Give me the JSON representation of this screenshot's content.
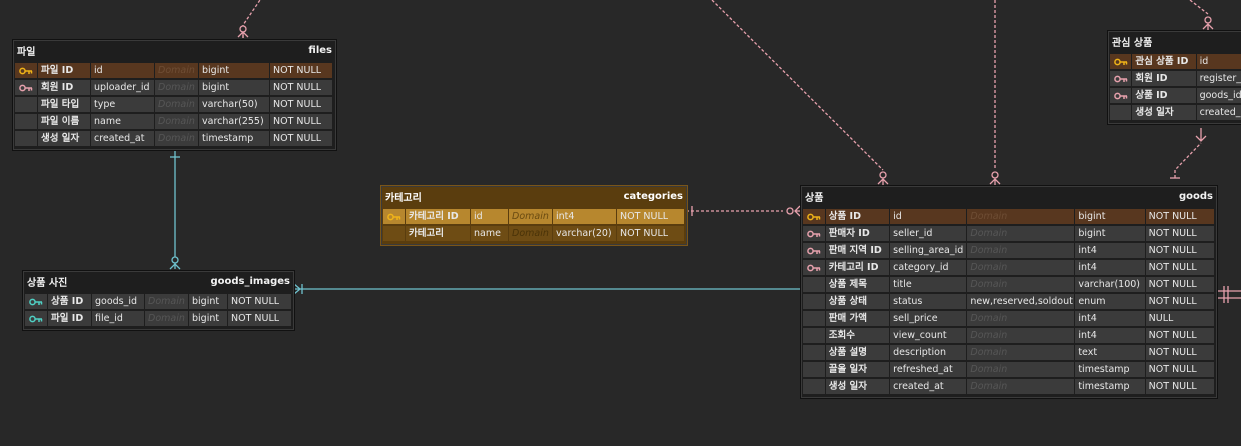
{
  "colors": {
    "background": "#282828",
    "pk_row": "#58371f",
    "selected_table": "#b7872e",
    "pk_key_icon": "#f0b418",
    "fk_key_icon": "#e7a1ad",
    "relation_pink": "#e7a1ad",
    "relation_cyan": "#6fc3cf"
  },
  "tables": {
    "files": {
      "logical": "파일",
      "physical": "files",
      "rows": [
        {
          "key": "pk",
          "lname": "파일 ID",
          "pname": "id",
          "domain": "Domain",
          "type": "bigint",
          "nullable": "NOT NULL"
        },
        {
          "key": "fk",
          "lname": "회원 ID",
          "pname": "uploader_id",
          "domain": "Domain",
          "type": "bigint",
          "nullable": "NOT NULL"
        },
        {
          "key": "",
          "lname": "파일 타입",
          "pname": "type",
          "domain": "Domain",
          "type": "varchar(50)",
          "nullable": "NOT NULL"
        },
        {
          "key": "",
          "lname": "파일 이름",
          "pname": "name",
          "domain": "Domain",
          "type": "varchar(255)",
          "nullable": "NOT NULL"
        },
        {
          "key": "",
          "lname": "생성 일자",
          "pname": "created_at",
          "domain": "Domain",
          "type": "timestamp",
          "nullable": "NOT NULL"
        }
      ]
    },
    "goods_images": {
      "logical": "상품 사진",
      "physical": "goods_images",
      "rows": [
        {
          "key": "pfk",
          "lname": "상품 ID",
          "pname": "goods_id",
          "domain": "Domain",
          "type": "bigint",
          "nullable": "NOT NULL"
        },
        {
          "key": "pfk",
          "lname": "파일 ID",
          "pname": "file_id",
          "domain": "Domain",
          "type": "bigint",
          "nullable": "NOT NULL"
        }
      ]
    },
    "categories": {
      "logical": "카테고리",
      "physical": "categories",
      "rows": [
        {
          "key": "pk",
          "lname": "카테고리 ID",
          "pname": "id",
          "domain": "Domain",
          "type": "int4",
          "nullable": "NOT NULL"
        },
        {
          "key": "",
          "lname": "카테고리",
          "pname": "name",
          "domain": "Domain",
          "type": "varchar(20)",
          "nullable": "NOT NULL"
        }
      ]
    },
    "goods": {
      "logical": "상품",
      "physical": "goods",
      "rows": [
        {
          "key": "pk",
          "lname": "상품 ID",
          "pname": "id",
          "domain": "Domain",
          "type": "bigint",
          "nullable": "NOT NULL"
        },
        {
          "key": "fk",
          "lname": "판매자 ID",
          "pname": "seller_id",
          "domain": "Domain",
          "type": "bigint",
          "nullable": "NOT NULL"
        },
        {
          "key": "fk",
          "lname": "판매 지역 ID",
          "pname": "selling_area_id",
          "domain": "Domain",
          "type": "int4",
          "nullable": "NOT NULL"
        },
        {
          "key": "fk",
          "lname": "카테고리 ID",
          "pname": "category_id",
          "domain": "Domain",
          "type": "int4",
          "nullable": "NOT NULL"
        },
        {
          "key": "",
          "lname": "상품 제목",
          "pname": "title",
          "domain": "Domain",
          "type": "varchar(100)",
          "nullable": "NOT NULL"
        },
        {
          "key": "",
          "lname": "상품 상태",
          "pname": "status",
          "domain": "new,reserved,soldout",
          "domainHas": true,
          "type": "enum",
          "nullable": "NOT NULL"
        },
        {
          "key": "",
          "lname": "판매 가액",
          "pname": "sell_price",
          "domain": "Domain",
          "type": "int4",
          "nullable": "NULL"
        },
        {
          "key": "",
          "lname": "조회수",
          "pname": "view_count",
          "domain": "Domain",
          "type": "int4",
          "nullable": "NOT NULL"
        },
        {
          "key": "",
          "lname": "상품 설명",
          "pname": "description",
          "domain": "Domain",
          "type": "text",
          "nullable": "NOT NULL"
        },
        {
          "key": "",
          "lname": "끌올 일자",
          "pname": "refreshed_at",
          "domain": "Domain",
          "type": "timestamp",
          "nullable": "NOT NULL"
        },
        {
          "key": "",
          "lname": "생성 일자",
          "pname": "created_at",
          "domain": "Domain",
          "type": "timestamp",
          "nullable": "NOT NULL"
        }
      ]
    },
    "interests": {
      "logical": "관심 상품",
      "physical": "",
      "rows": [
        {
          "key": "pk",
          "lname": "관심 상품 ID",
          "pname": "id",
          "domain": "",
          "type": "",
          "nullable": ""
        },
        {
          "key": "fk",
          "lname": "회원 ID",
          "pname": "register_",
          "domain": "",
          "type": "",
          "nullable": ""
        },
        {
          "key": "fk",
          "lname": "상품 ID",
          "pname": "goods_id",
          "domain": "",
          "type": "",
          "nullable": ""
        },
        {
          "key": "",
          "lname": "생성 일자",
          "pname": "created_",
          "domain": "",
          "type": "",
          "nullable": ""
        }
      ]
    }
  }
}
